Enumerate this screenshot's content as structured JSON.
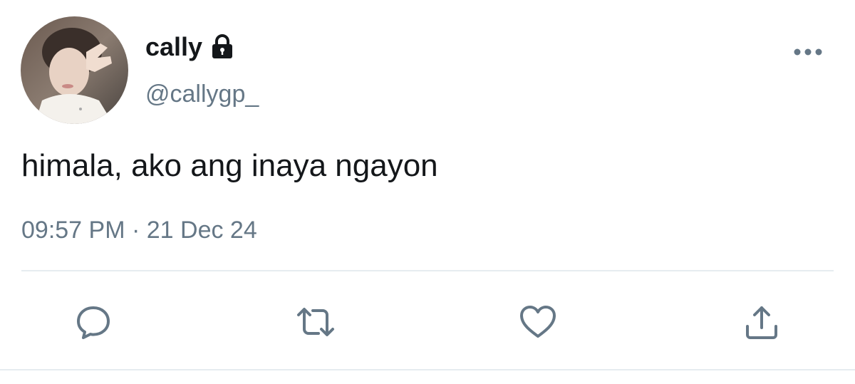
{
  "tweet": {
    "display_name": "cally",
    "handle": "@callygp_",
    "text": "himala, ako ang inaya ngayon",
    "timestamp": "09:57 PM · 21 Dec 24",
    "protected_icon": "lock-icon",
    "avatar": "profile-photo"
  },
  "actions": {
    "icons": [
      "reply-icon",
      "retweet-icon",
      "like-icon",
      "share-icon"
    ],
    "more_icon": "more-options-icon"
  },
  "colors": {
    "text_primary": "#14171a",
    "text_secondary": "#657786",
    "icon": "#657786",
    "divider": "#e6ecf0"
  }
}
